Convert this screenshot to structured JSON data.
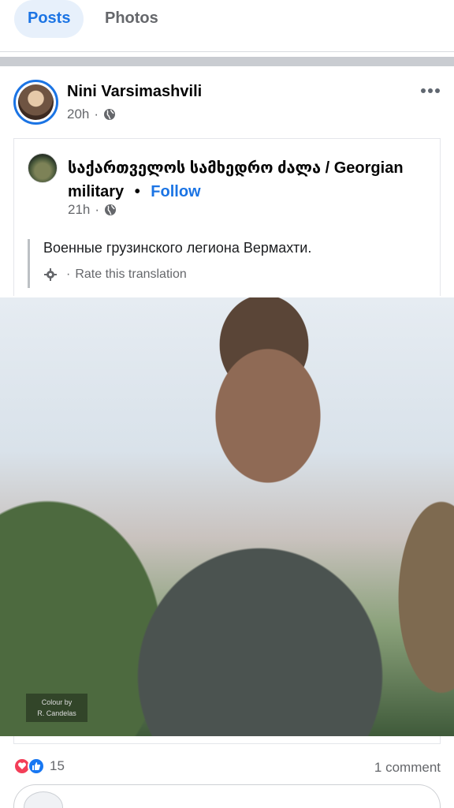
{
  "tabs": {
    "posts": "Posts",
    "photos": "Photos"
  },
  "post": {
    "author": "Nini Varsimashvili",
    "time": "20h",
    "separator": "·",
    "shared": {
      "page_name": "საქართველოს სამხედრო ძალა / Georgian military",
      "bullet": "•",
      "follow": "Follow",
      "time": "21h",
      "text": "Военные грузинского легиона Вермахти.",
      "rate_translation": "Rate this translation"
    },
    "photo_caption_line1": "Colour by",
    "photo_caption_line2": "R. Candelas",
    "reaction_count": "15",
    "comments": "1 comment"
  },
  "colors": {
    "accent": "#1b74e4",
    "love": "#f33e58",
    "like": "#1877f2",
    "meta": "#65676b"
  },
  "icons": [
    "globe-icon",
    "more-icon",
    "gear-icon",
    "love-reaction-icon",
    "like-reaction-icon"
  ]
}
